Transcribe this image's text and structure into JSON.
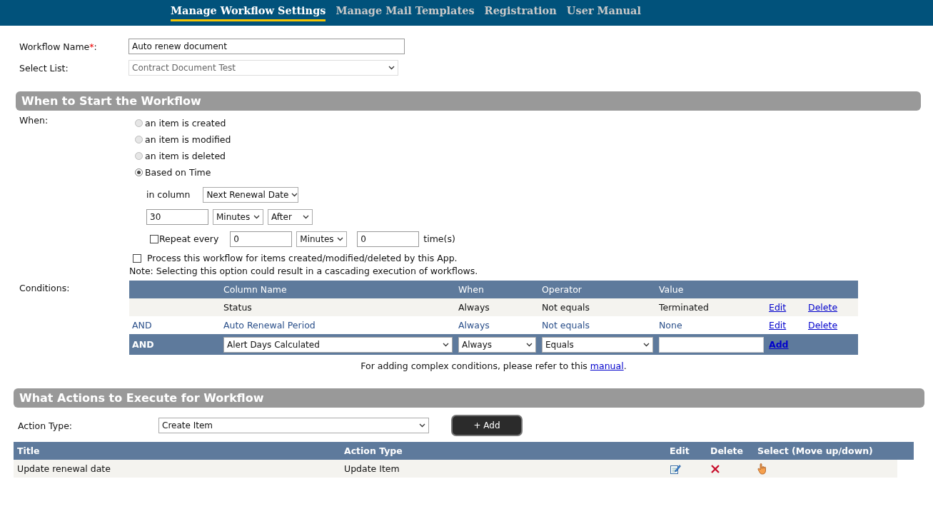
{
  "nav": [
    {
      "label": "Manage Workflow Settings",
      "selected": true
    },
    {
      "label": "Manage Mail Templates",
      "selected": false
    },
    {
      "label": "Registration",
      "selected": false
    },
    {
      "label": "User Manual",
      "selected": false
    }
  ],
  "workflow_name": {
    "label": "Workflow Name",
    "required_mark": "*",
    "label_suffix": ":",
    "value": "Auto renew document"
  },
  "select_list": {
    "label": "Select List:",
    "value": "Contract Document Test",
    "disabled": true
  },
  "start_section": {
    "title": "When to Start the Workflow",
    "when_label": "When:",
    "triggers": [
      {
        "label": "an item is created",
        "selected": false
      },
      {
        "label": "an item is modified",
        "selected": false
      },
      {
        "label": "an item is deleted",
        "selected": false
      },
      {
        "label": "Based on Time",
        "selected": true
      }
    ],
    "column_label": "in column",
    "column_value": "Next Renewal Date",
    "offset_value": "30",
    "offset_unit": "Minutes",
    "offset_direction": "After",
    "repeat": {
      "label": "Repeat every",
      "checked": false,
      "interval": "0",
      "unit": "Minutes",
      "count": "0",
      "count_suffix": "time(s)"
    },
    "process": {
      "label": "Process this workflow for items created/modified/deleted by this App.",
      "checked": false
    },
    "note": "Note: Selecting this option could result in a cascading execution of workflows."
  },
  "conditions": {
    "label": "Conditions:",
    "columns": [
      "Column Name",
      "When",
      "Operator",
      "Value"
    ],
    "rows": [
      {
        "column": "Status",
        "when": "Always",
        "operator": "Not equals",
        "value": "Terminated",
        "edit": "Edit",
        "delete": "Delete"
      },
      {
        "connector": "AND",
        "column": "Auto Renewal Period",
        "when": "Always",
        "operator": "Not equals",
        "value": "None",
        "edit": "Edit",
        "delete": "Delete"
      }
    ],
    "new_row": {
      "connector": "AND",
      "column": "Alert Days Calculated",
      "when": "Always",
      "operator": "Equals",
      "add": "Add"
    },
    "help": {
      "text": "For adding complex conditions, please refer to this ",
      "link": "manual",
      "suffix": "."
    }
  },
  "actions_section": {
    "title": "What Actions to Execute for Workflow",
    "action_type_label": "Action Type:",
    "action_type_value": "Create Item",
    "add_button": "+ Add",
    "columns": [
      "Title",
      "Action Type",
      "Edit",
      "Delete",
      "Select (Move up/down)"
    ],
    "rows": [
      {
        "title": "Update renewal date",
        "action_type": "Update Item"
      }
    ]
  }
}
